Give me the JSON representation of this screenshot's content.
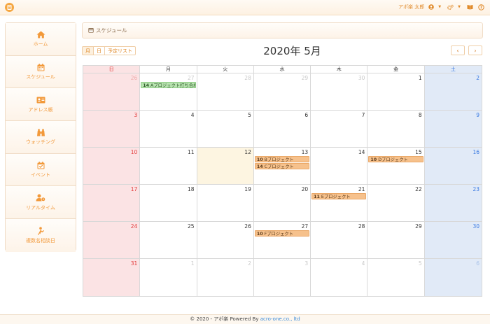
{
  "topbar": {
    "user_name": "アポ楽 太郎",
    "icons": [
      "user-icon",
      "gears-icon",
      "book-icon",
      "help-icon"
    ]
  },
  "sidebar": {
    "items": [
      {
        "label": "ホーム",
        "icon": "home-icon"
      },
      {
        "label": "スケジュール",
        "icon": "calendar-icon"
      },
      {
        "label": "アドレス帳",
        "icon": "address-card-icon"
      },
      {
        "label": "ウォッチング",
        "icon": "binoculars-icon"
      },
      {
        "label": "イベント",
        "icon": "calendar-check-icon"
      },
      {
        "label": "リアルタイム",
        "icon": "user-clock-icon"
      },
      {
        "label": "複数名相談日",
        "icon": "multi-user-icon"
      }
    ]
  },
  "header": {
    "title": "スケジュール"
  },
  "view_buttons": {
    "month": "月",
    "day": "日",
    "list": "予定リスト"
  },
  "calendar": {
    "title": "2020年 5月",
    "prev_label": "‹",
    "next_label": "›",
    "weekdays": [
      "日",
      "月",
      "火",
      "水",
      "木",
      "金",
      "土"
    ],
    "weeks": [
      [
        {
          "d": "26",
          "other": true,
          "events": []
        },
        {
          "d": "27",
          "other": true,
          "events": [
            {
              "time": "14",
              "title": "Aプロジェクト打ち合わせ",
              "color": "green"
            }
          ]
        },
        {
          "d": "28",
          "other": true,
          "events": []
        },
        {
          "d": "29",
          "other": true,
          "events": []
        },
        {
          "d": "30",
          "other": true,
          "events": []
        },
        {
          "d": "1",
          "other": false,
          "events": []
        },
        {
          "d": "2",
          "other": false,
          "events": []
        }
      ],
      [
        {
          "d": "3",
          "other": false,
          "events": []
        },
        {
          "d": "4",
          "other": false,
          "events": []
        },
        {
          "d": "5",
          "other": false,
          "events": []
        },
        {
          "d": "6",
          "other": false,
          "events": []
        },
        {
          "d": "7",
          "other": false,
          "events": []
        },
        {
          "d": "8",
          "other": false,
          "events": []
        },
        {
          "d": "9",
          "other": false,
          "events": []
        }
      ],
      [
        {
          "d": "10",
          "other": false,
          "events": []
        },
        {
          "d": "11",
          "other": false,
          "events": []
        },
        {
          "d": "12",
          "other": false,
          "today": true,
          "events": []
        },
        {
          "d": "13",
          "other": false,
          "events": [
            {
              "time": "10",
              "title": "Bプロジェクト",
              "color": "orange"
            },
            {
              "time": "14",
              "title": "Cプロジェクト",
              "color": "orange"
            }
          ]
        },
        {
          "d": "14",
          "other": false,
          "events": []
        },
        {
          "d": "15",
          "other": false,
          "events": [
            {
              "time": "10",
              "title": "Dプロジェクト",
              "color": "orange"
            }
          ]
        },
        {
          "d": "16",
          "other": false,
          "events": []
        }
      ],
      [
        {
          "d": "17",
          "other": false,
          "events": []
        },
        {
          "d": "18",
          "other": false,
          "events": []
        },
        {
          "d": "19",
          "other": false,
          "events": []
        },
        {
          "d": "20",
          "other": false,
          "events": []
        },
        {
          "d": "21",
          "other": false,
          "events": [
            {
              "time": "11",
              "title": "Eプロジェクト",
              "color": "orange"
            }
          ]
        },
        {
          "d": "22",
          "other": false,
          "events": []
        },
        {
          "d": "23",
          "other": false,
          "events": []
        }
      ],
      [
        {
          "d": "24",
          "other": false,
          "events": []
        },
        {
          "d": "25",
          "other": false,
          "events": []
        },
        {
          "d": "26",
          "other": false,
          "events": []
        },
        {
          "d": "27",
          "other": false,
          "events": [
            {
              "time": "10",
              "title": "Fプロジェクト",
              "color": "orange"
            }
          ]
        },
        {
          "d": "28",
          "other": false,
          "events": []
        },
        {
          "d": "29",
          "other": false,
          "events": []
        },
        {
          "d": "30",
          "other": false,
          "events": []
        }
      ],
      [
        {
          "d": "31",
          "other": false,
          "events": []
        },
        {
          "d": "1",
          "other": true,
          "events": []
        },
        {
          "d": "2",
          "other": true,
          "events": []
        },
        {
          "d": "3",
          "other": true,
          "events": []
        },
        {
          "d": "4",
          "other": true,
          "events": []
        },
        {
          "d": "5",
          "other": true,
          "events": []
        },
        {
          "d": "6",
          "other": true,
          "events": []
        }
      ]
    ]
  },
  "footer": {
    "text": "© 2020 - アポ楽 Powered By ",
    "link": "acro-one.co., ltd"
  },
  "colors": {
    "accent": "#f2993a",
    "event_orange": "#f6c18c",
    "event_green": "#b8e3b0",
    "sunday_bg": "#fbe3e4",
    "saturday_bg": "#e1eaf7",
    "today_bg": "#fdf5e1"
  }
}
